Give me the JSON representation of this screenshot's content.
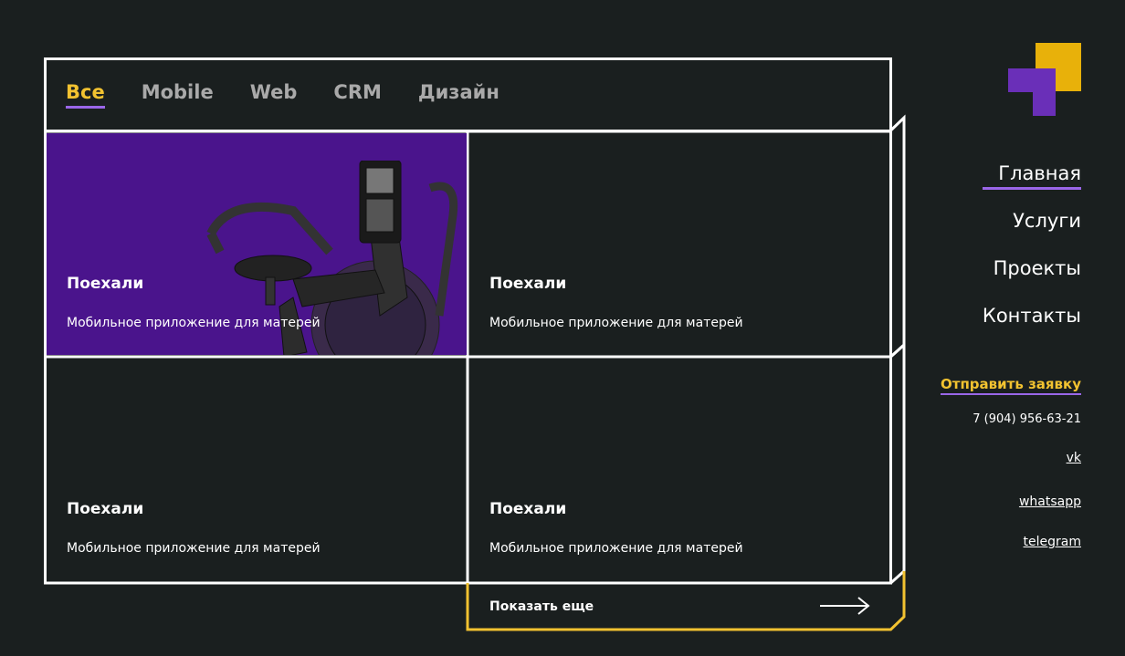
{
  "tabs": [
    {
      "label": "Все",
      "active": true
    },
    {
      "label": "Mobile",
      "active": false
    },
    {
      "label": "Web",
      "active": false
    },
    {
      "label": "CRM",
      "active": false
    },
    {
      "label": "Дизайн",
      "active": false
    }
  ],
  "cards": [
    {
      "title": "Поехали",
      "subtitle": "Мобильное приложение для матерей",
      "has_image": true
    },
    {
      "title": "Поехали",
      "subtitle": "Мобильное приложение для матерей",
      "has_image": false
    },
    {
      "title": "Поехали",
      "subtitle": "Мобильное приложение для матерей",
      "has_image": false
    },
    {
      "title": "Поехали",
      "subtitle": "Мобильное приложение для матерей",
      "has_image": false
    }
  ],
  "show_more": {
    "label": "Показать еще",
    "icon": "arrow-right-icon"
  },
  "nav": {
    "items": [
      {
        "label": "Главная",
        "active": true
      },
      {
        "label": "Услуги",
        "active": false
      },
      {
        "label": "Проекты",
        "active": false
      },
      {
        "label": "Контакты",
        "active": false
      }
    ]
  },
  "contact": {
    "request_label": "Отправить заявку",
    "phone": "7 (904) 956-63-21",
    "vk": "vk",
    "whatsapp": "whatsapp",
    "telegram": "telegram"
  },
  "colors": {
    "background": "#1a1f1f",
    "accent_yellow": "#f2c230",
    "accent_purple": "#9a66e8",
    "card_purple": "#4a148c",
    "frame": "#ffffff"
  }
}
